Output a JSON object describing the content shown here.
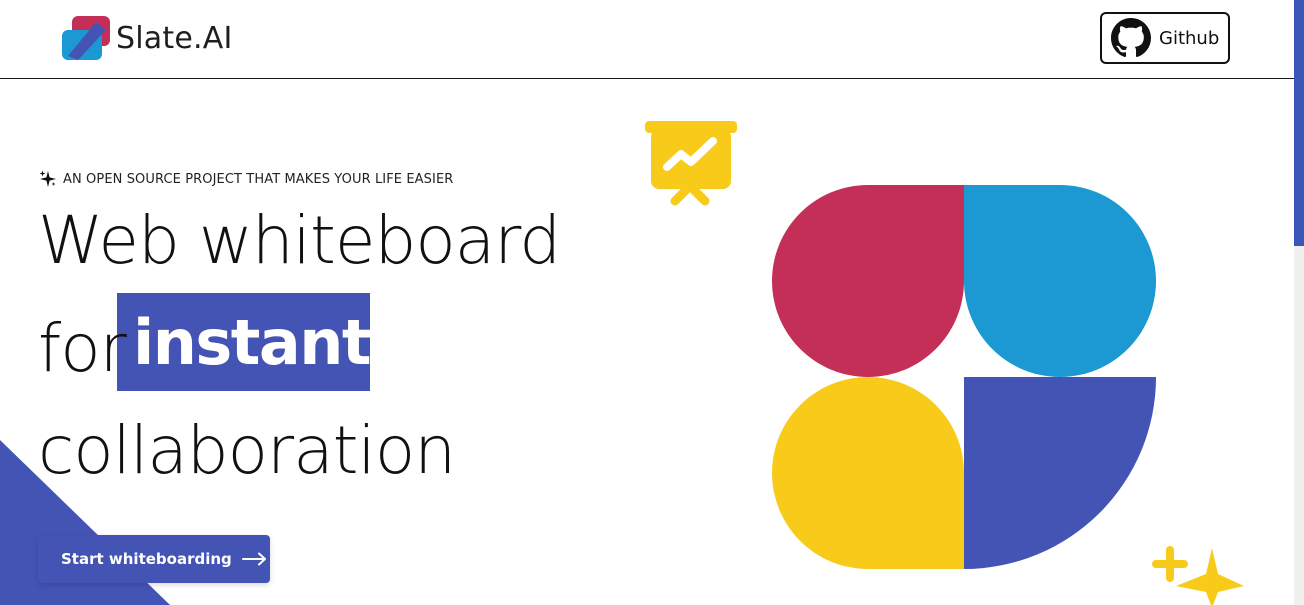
{
  "header": {
    "brand_name": "Slate.AI",
    "github_label": "Github"
  },
  "hero": {
    "tagline": "AN OPEN SOURCE PROJECT THAT MAKES YOUR LIFE EASIER",
    "line1": "Web whiteboard",
    "line2_prefix": "for",
    "line2_highlight": "instant",
    "line3": "collaboration",
    "cta_label": "Start whiteboarding"
  },
  "icons": {
    "brand": "slate-logo-icon",
    "github": "github-icon",
    "tagline": "sparkle-icon",
    "cta": "arrow-right-icon",
    "presentation": "presentation-chart-icon",
    "decoration": "sparkle-star-icon"
  },
  "colors": {
    "accent": "#4454b5",
    "red": "#c42f57",
    "blue": "#1c98d2",
    "yellow": "#f8cb1b",
    "text": "#111111"
  }
}
